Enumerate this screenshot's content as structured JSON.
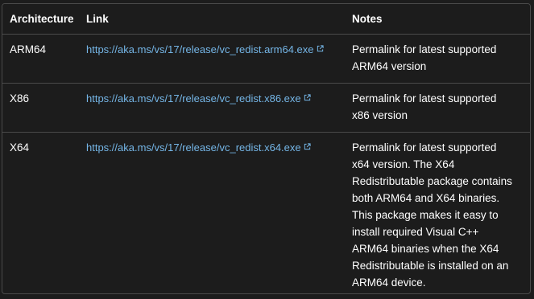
{
  "table": {
    "headers": {
      "architecture": "Architecture",
      "link": "Link",
      "notes": "Notes"
    },
    "rows": [
      {
        "architecture": "ARM64",
        "link": "https://aka.ms/vs/17/release/vc_redist.arm64.exe",
        "notes": "Permalink for latest supported ARM64 version"
      },
      {
        "architecture": "X86",
        "link": "https://aka.ms/vs/17/release/vc_redist.x86.exe",
        "notes": "Permalink for latest supported x86 version"
      },
      {
        "architecture": "X64",
        "link": "https://aka.ms/vs/17/release/vc_redist.x64.exe",
        "notes": "Permalink for latest supported x64 version. The X64 Redistributable package contains both ARM64 and X64 binaries. This package makes it easy to install required Visual C++ ARM64 binaries when the X64 Redistributable is installed on an ARM64 device."
      }
    ]
  },
  "icons": {
    "external_link": "external-link-icon"
  },
  "colors": {
    "background": "#1c1c1c",
    "border": "#4a4a4a",
    "link": "#75b6e7",
    "text": "#ffffff"
  }
}
